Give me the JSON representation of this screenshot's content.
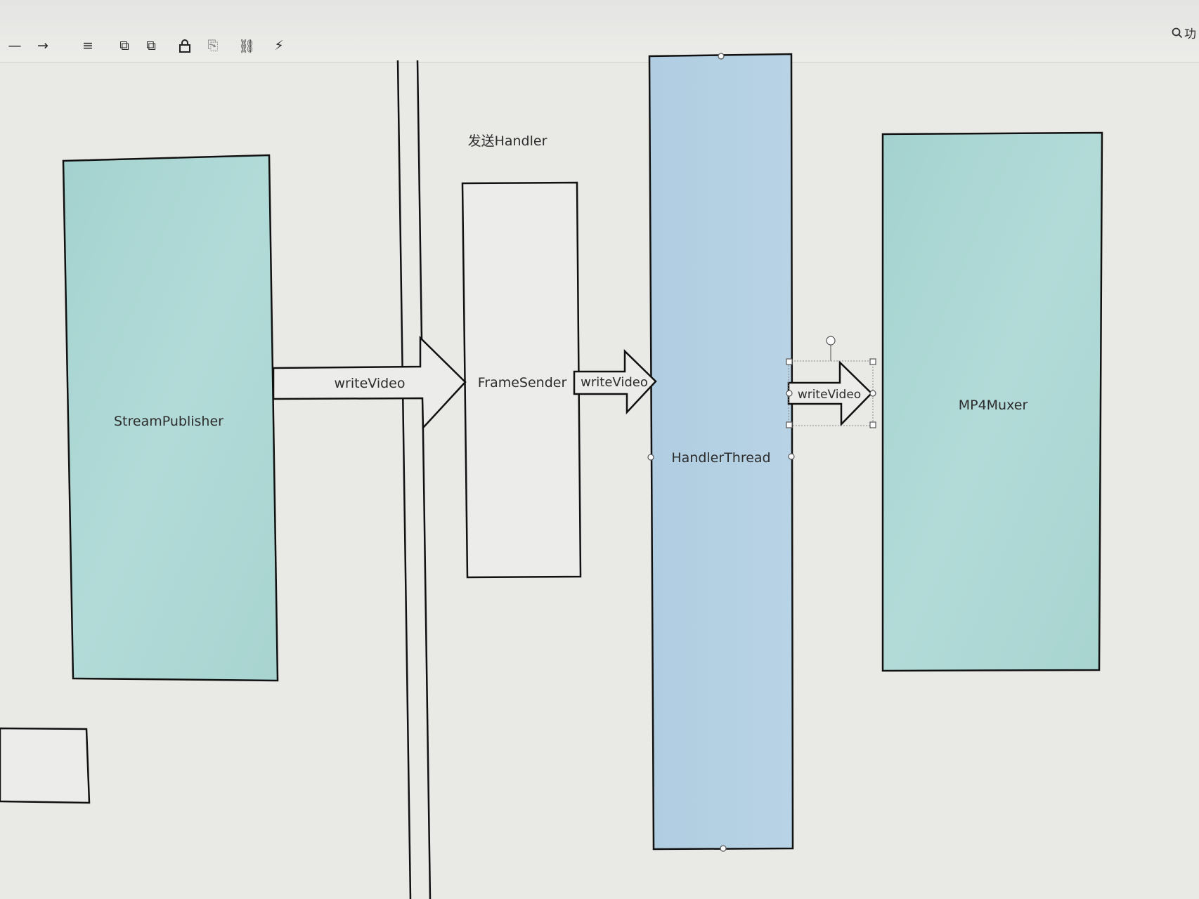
{
  "toolbar": {
    "items": [
      {
        "name": "line-tool-icon",
        "glyph": "—"
      },
      {
        "name": "arrow-tool-icon",
        "glyph": "→"
      },
      {
        "name": "align-icon",
        "glyph": "≡"
      },
      {
        "name": "bring-forward-icon",
        "glyph": "⧉"
      },
      {
        "name": "send-backward-icon",
        "glyph": "⧉"
      },
      {
        "name": "lock-icon",
        "glyph": "🔒"
      },
      {
        "name": "unlock-icon",
        "glyph": "⎘"
      },
      {
        "name": "link-icon",
        "glyph": "⛓"
      },
      {
        "name": "magic-wand-icon",
        "glyph": "⚡"
      }
    ],
    "search_icon": "search-icon",
    "search_label": "功"
  },
  "diagram": {
    "box_stream_publisher": "StreamPublisher",
    "section_label": "发送Handler",
    "box_frame_sender": "FrameSender",
    "box_handler_thread": "HandlerThread",
    "box_mp4_muxer": "MP4Muxer",
    "arrow_1": "writeVideo",
    "arrow_2": "writeVideo",
    "arrow_3": "writeVideo"
  },
  "colors": {
    "teal_fill": "#a9d6d3",
    "blue_fill": "#b4d0e3",
    "frame_fill": "#ececea",
    "canvas_bg": "#e9e9e6",
    "stroke": "#111111"
  }
}
